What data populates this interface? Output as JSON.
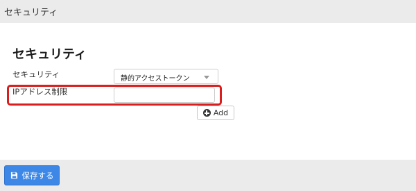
{
  "topbar": {
    "title": "セキュリティ"
  },
  "section": {
    "heading": "セキュリティ"
  },
  "security_field": {
    "label": "セキュリティ",
    "selected_value": "静的アクセストークン"
  },
  "ip_field": {
    "label": "IPアドレス制限",
    "value": ""
  },
  "add_button": {
    "label": "Add",
    "icon": "plus-circle-icon"
  },
  "footer": {
    "save_button": {
      "label": "保存する",
      "icon": "floppy-disk-icon"
    }
  },
  "colors": {
    "highlight": "#d81e1e",
    "primary_button": "#3d87e6",
    "bar_background": "#ebebeb"
  }
}
